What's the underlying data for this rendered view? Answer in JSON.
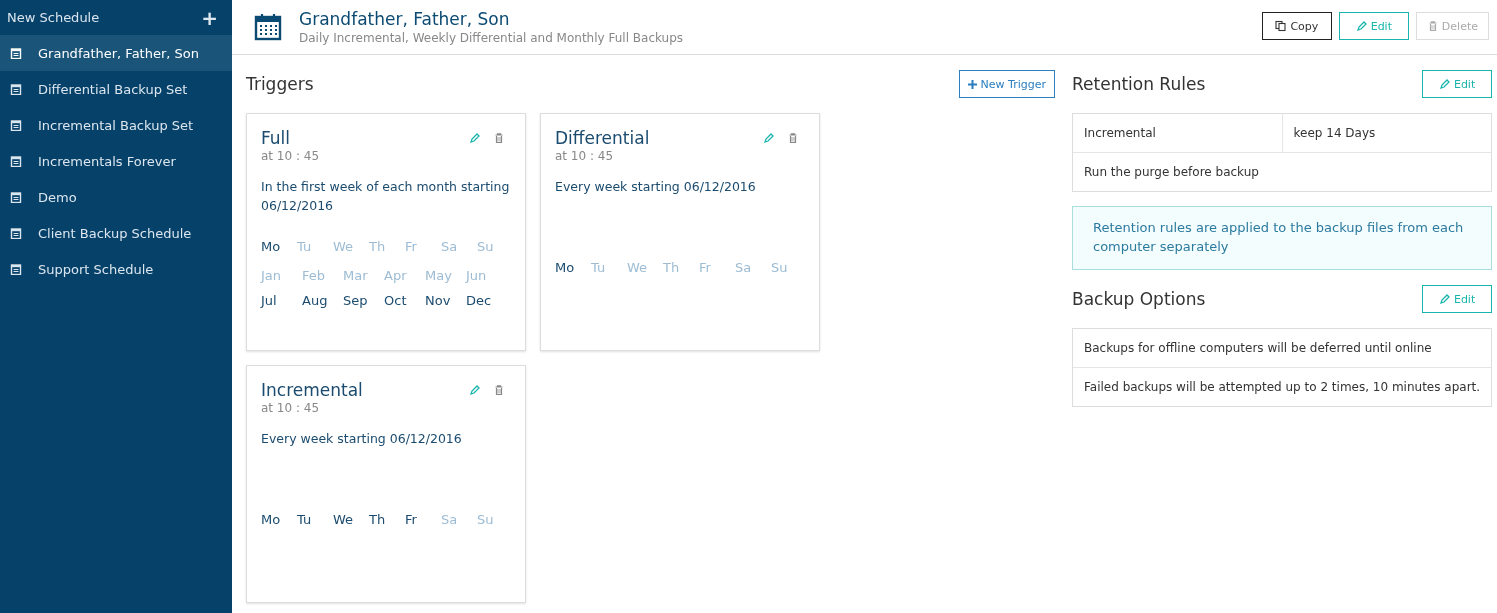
{
  "sidebar": {
    "new_label": "New Schedule",
    "new_icon": "+",
    "items": [
      {
        "label": "Grandfather, Father, Son",
        "selected": true
      },
      {
        "label": "Differential Backup Set",
        "selected": false
      },
      {
        "label": "Incremental Backup Set",
        "selected": false
      },
      {
        "label": "Incrementals Forever",
        "selected": false
      },
      {
        "label": "Demo",
        "selected": false
      },
      {
        "label": "Client Backup Schedule",
        "selected": false
      },
      {
        "label": "Support Schedule",
        "selected": false
      }
    ]
  },
  "header": {
    "title": "Grandfather, Father, Son",
    "subtitle": "Daily Incremental, Weekly Differential and Monthly Full Backups",
    "buttons": [
      {
        "label": "Copy",
        "kind": "copy",
        "disabled": false
      },
      {
        "label": "Edit",
        "kind": "edit",
        "disabled": false
      },
      {
        "label": "Delete",
        "kind": "delete",
        "disabled": true
      }
    ]
  },
  "triggers": {
    "title": "Triggers",
    "new_button": "New Trigger",
    "items": [
      {
        "name": "Full",
        "time": "at 10 : 45",
        "description": "In the first week of each month starting 06/12/2016",
        "days": [
          {
            "label": "Mo",
            "on": true
          },
          {
            "label": "Tu",
            "on": false
          },
          {
            "label": "We",
            "on": false
          },
          {
            "label": "Th",
            "on": false
          },
          {
            "label": "Fr",
            "on": false
          },
          {
            "label": "Sa",
            "on": false
          },
          {
            "label": "Su",
            "on": false
          }
        ],
        "months": [
          {
            "label": "Jan",
            "on": false
          },
          {
            "label": "Feb",
            "on": false
          },
          {
            "label": "Mar",
            "on": false
          },
          {
            "label": "Apr",
            "on": false
          },
          {
            "label": "May",
            "on": false
          },
          {
            "label": "Jun",
            "on": false
          },
          {
            "label": "Jul",
            "on": true
          },
          {
            "label": "Aug",
            "on": true
          },
          {
            "label": "Sep",
            "on": true
          },
          {
            "label": "Oct",
            "on": true
          },
          {
            "label": "Nov",
            "on": true
          },
          {
            "label": "Dec",
            "on": true
          }
        ]
      },
      {
        "name": "Differential",
        "time": "at 10 : 45",
        "description": "Every week starting 06/12/2016",
        "days": [
          {
            "label": "Mo",
            "on": true
          },
          {
            "label": "Tu",
            "on": false
          },
          {
            "label": "We",
            "on": false
          },
          {
            "label": "Th",
            "on": false
          },
          {
            "label": "Fr",
            "on": false
          },
          {
            "label": "Sa",
            "on": false
          },
          {
            "label": "Su",
            "on": false
          }
        ]
      },
      {
        "name": "Incremental",
        "time": "at 10 : 45",
        "description": "Every week starting 06/12/2016",
        "days": [
          {
            "label": "Mo",
            "on": true
          },
          {
            "label": "Tu",
            "on": true
          },
          {
            "label": "We",
            "on": true
          },
          {
            "label": "Th",
            "on": true
          },
          {
            "label": "Fr",
            "on": true
          },
          {
            "label": "Sa",
            "on": false
          },
          {
            "label": "Su",
            "on": false
          }
        ]
      }
    ]
  },
  "retention": {
    "title": "Retention Rules",
    "edit_button": "Edit",
    "rule": {
      "type": "Incremental",
      "value": "keep 14 Days"
    },
    "purge": "Run the purge before backup",
    "note": "Retention rules are applied to the backup files from each computer separately"
  },
  "backup_options": {
    "title": "Backup Options",
    "edit_button": "Edit",
    "items": [
      "Backups for offline computers will be deferred until online",
      "Failed backups will be attempted up to 2 times, 10 minutes apart."
    ]
  }
}
